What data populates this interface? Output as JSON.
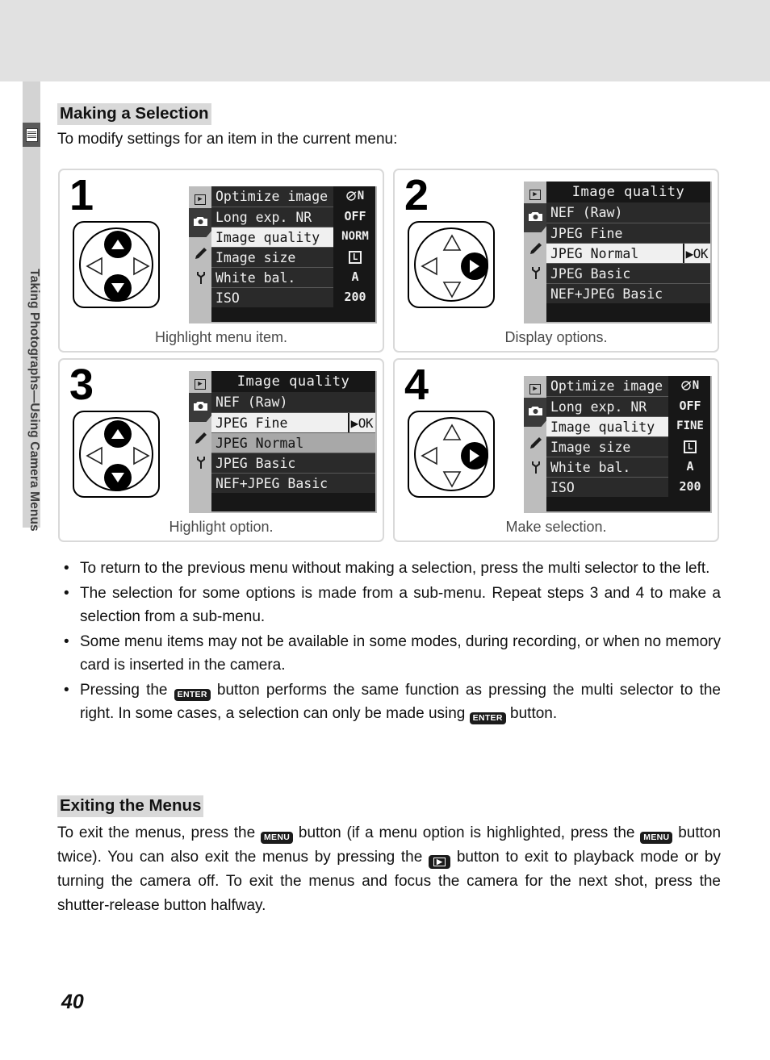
{
  "page": {
    "number": "40",
    "sidebar_label": "Taking Photographs—Using Camera Menus",
    "sidebar_icon": "menu-list-icon"
  },
  "sections": {
    "making": {
      "heading": "Making a Selection",
      "intro": "To modify settings for an item in the current menu:"
    },
    "exiting": {
      "heading": "Exiting the Menus",
      "body_1": "To exit the menus, press the",
      "body_2": "button (if a menu option is highlighted, press the",
      "body_3": "button twice).  You can also exit the menus by pressing the",
      "body_4": "button to exit to playback mode or by turning the camera off.  To exit the menus and focus the camera for the next shot, press the shutter-release button halfway."
    }
  },
  "steps": [
    {
      "number": "1",
      "caption": "Highlight menu item.",
      "dial": {
        "up": "active",
        "down": "active",
        "left": "idle",
        "right": "idle"
      },
      "lcd": {
        "kind": "main-menu",
        "title": null,
        "rail": [
          "playback-icon",
          "camera-icon",
          "pencil-icon",
          "wrench-icon"
        ],
        "rail_active": "camera-icon",
        "rows": [
          {
            "label": "Optimize image",
            "value": "N",
            "value_icon": "optimize-icon",
            "state": "normal"
          },
          {
            "label": "Long exp. NR",
            "value": "OFF",
            "state": "normal"
          },
          {
            "label": "Image quality",
            "value": "NORM",
            "state": "selected"
          },
          {
            "label": "Image size",
            "value": "L",
            "value_icon": "size-box-icon",
            "state": "normal"
          },
          {
            "label": "White bal.",
            "value": "A",
            "state": "normal"
          },
          {
            "label": "ISO",
            "value": "200",
            "state": "normal"
          }
        ]
      }
    },
    {
      "number": "2",
      "caption": "Display options.",
      "dial": {
        "up": "idle",
        "down": "idle",
        "left": "idle",
        "right": "active"
      },
      "lcd": {
        "kind": "sub-menu",
        "title": "Image quality",
        "rail": [
          "playback-icon",
          "camera-icon",
          "pencil-icon",
          "wrench-icon"
        ],
        "rail_active": "camera-icon",
        "rows": [
          {
            "label": "NEF (Raw)",
            "state": "normal"
          },
          {
            "label": "JPEG Fine",
            "state": "normal"
          },
          {
            "label": "JPEG Normal",
            "state": "selected",
            "badge": "▶OK"
          },
          {
            "label": "JPEG Basic",
            "state": "normal"
          },
          {
            "label": "NEF+JPEG Basic",
            "state": "normal"
          }
        ]
      }
    },
    {
      "number": "3",
      "caption": "Highlight option.",
      "dial": {
        "up": "active",
        "down": "active",
        "left": "idle",
        "right": "idle"
      },
      "lcd": {
        "kind": "sub-menu",
        "title": "Image quality",
        "rail": [
          "playback-icon",
          "camera-icon",
          "pencil-icon",
          "wrench-icon"
        ],
        "rail_active": "camera-icon",
        "rows": [
          {
            "label": "NEF (Raw)",
            "state": "normal"
          },
          {
            "label": "JPEG Fine",
            "state": "selected",
            "badge": "▶OK"
          },
          {
            "label": "JPEG Normal",
            "state": "dim-selected"
          },
          {
            "label": "JPEG Basic",
            "state": "normal"
          },
          {
            "label": "NEF+JPEG Basic",
            "state": "normal"
          }
        ]
      }
    },
    {
      "number": "4",
      "caption": "Make selection.",
      "dial": {
        "up": "idle",
        "down": "idle",
        "left": "idle",
        "right": "active"
      },
      "lcd": {
        "kind": "main-menu",
        "title": null,
        "rail": [
          "playback-icon",
          "camera-icon",
          "pencil-icon",
          "wrench-icon"
        ],
        "rail_active": "camera-icon",
        "rows": [
          {
            "label": "Optimize image",
            "value": "N",
            "value_icon": "optimize-icon",
            "state": "normal"
          },
          {
            "label": "Long exp. NR",
            "value": "OFF",
            "state": "normal"
          },
          {
            "label": "Image quality",
            "value": "FINE",
            "state": "selected"
          },
          {
            "label": "Image size",
            "value": "L",
            "value_icon": "size-box-icon",
            "state": "normal"
          },
          {
            "label": "White bal.",
            "value": "A",
            "state": "normal"
          },
          {
            "label": "ISO",
            "value": "200",
            "state": "normal"
          }
        ]
      }
    }
  ],
  "bullets": [
    {
      "text": "To return to the previous menu without making a selection, press the multi selector to the left."
    },
    {
      "text": "The selection for some options is made from a sub-menu.  Repeat steps 3 and 4 to make a selection from a sub-menu."
    },
    {
      "text": "Some menu items may not be available in some modes, during recording, or when no memory card is inserted in the camera."
    },
    {
      "text_1": "Pressing the",
      "text_2": "button performs the same function as pressing the multi selector to the right.  In some cases, a selection can only be made using",
      "text_3": "button.",
      "icon": "ENTER"
    }
  ],
  "icons": {
    "enter_button": "ENTER",
    "menu_button": "MENU",
    "playback_button": "playback-icon"
  },
  "colors": {
    "band": "#e1e1e1",
    "heading_highlight": "#d9d9d9",
    "panel_border": "#d9d9d9",
    "lcd_bezel": "#b7b7b7",
    "lcd_screen": "#171717",
    "lcd_row": "#2a2a2a",
    "lcd_selected": "#f0f0f0",
    "sidebar": "#d3d3d3"
  }
}
